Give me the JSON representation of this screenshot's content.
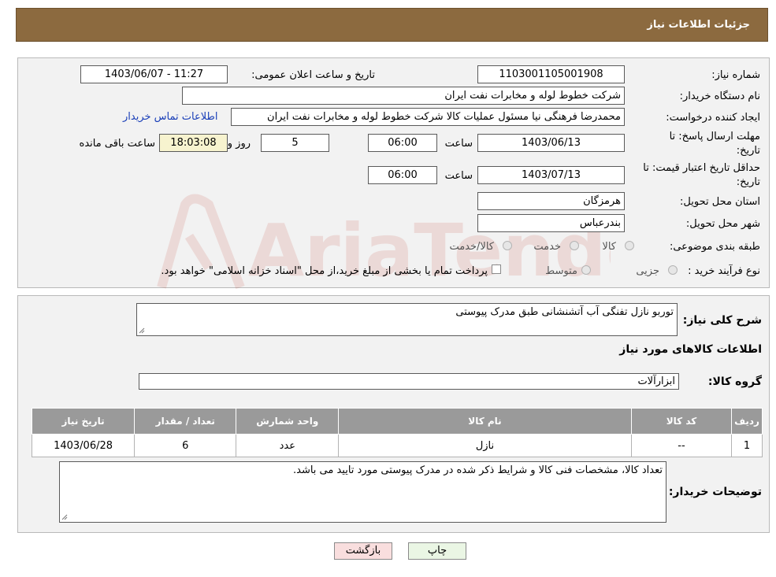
{
  "header": {
    "title": "جزئیات اطلاعات نیاز"
  },
  "form": {
    "need_number_label": "شماره نیاز:",
    "need_number": "1103001105001908",
    "announce_label": "تاریخ و ساعت اعلان عمومی:",
    "announce_value": "1403/06/07 - 11:27",
    "buyer_org_label": "نام دستگاه خریدار:",
    "buyer_org": "شرکت خطوط لوله و مخابرات نفت ایران",
    "creator_label": "ایجاد کننده درخواست:",
    "creator": "محمدرضا فرهنگی نیا مسئول عملیات کالا شرکت خطوط لوله و مخابرات نفت ایران",
    "contact_link": "اطلاعات تماس خریدار",
    "deadline_label": "مهلت ارسال پاسخ: تا تاریخ:",
    "deadline_date": "1403/06/13",
    "time_label": "ساعت",
    "deadline_time": "06:00",
    "days_value": "5",
    "days_label": "روز و",
    "remaining_value": "18:03:08",
    "remaining_label": "ساعت باقی مانده",
    "validity_label": "حداقل تاریخ اعتبار قیمت: تا تاریخ:",
    "validity_date": "1403/07/13",
    "validity_time": "06:00",
    "province_label": "استان محل تحویل:",
    "province": "هرمزگان",
    "city_label": "شهر محل تحویل:",
    "city": "بندرعباس",
    "category_label": "طبقه بندی موضوعی:",
    "category_options": [
      "کالا",
      "خدمت",
      "کالا/خدمت"
    ],
    "process_label": "نوع فرآیند خرید :",
    "process_options": [
      "جزیی",
      "متوسط"
    ],
    "process_note": "پرداخت تمام یا بخشی از مبلغ خرید،از محل \"اسناد خزانه اسلامی\" خواهد بود."
  },
  "details": {
    "summary_label": "شرح کلی نیاز:",
    "summary": "توربو نازل تفنگی آب آتشنشانی طبق مدرک پیوستی",
    "goods_info_title": "اطلاعات کالاهای مورد نیاز",
    "group_label": "گروه کالا:",
    "group_value": "ابزارآلات",
    "table": {
      "headers": [
        "ردیف",
        "کد کالا",
        "نام کالا",
        "واحد شمارش",
        "تعداد / مقدار",
        "تاریخ نیاز"
      ],
      "rows": [
        [
          "1",
          "--",
          "نازل",
          "عدد",
          "6",
          "1403/06/28"
        ]
      ]
    },
    "buyer_notes_label": "توضیحات خریدار:",
    "buyer_notes": "تعداد کالا، مشخصات فنی کالا و شرایط ذکر شده در مدرک پیوستی مورد تایید می باشد."
  },
  "buttons": {
    "print": "چاپ",
    "back": "بازگشت"
  },
  "watermark_text": "AriaTender.neT"
}
